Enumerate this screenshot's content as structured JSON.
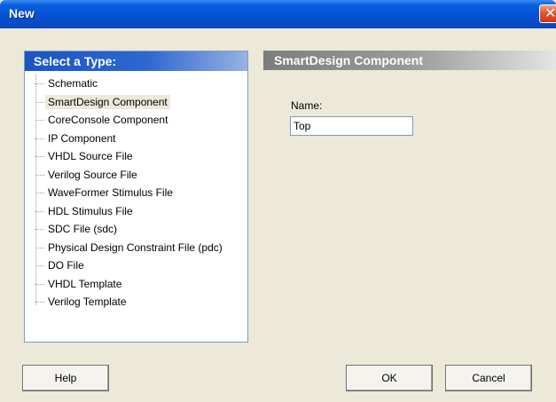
{
  "window": {
    "title": "New",
    "close_glyph": "✕",
    "close_icon": "close-icon"
  },
  "list": {
    "header": "Select a Type:",
    "items": [
      {
        "label": "Schematic"
      },
      {
        "label": "SmartDesign Component",
        "selected": true
      },
      {
        "label": "CoreConsole Component"
      },
      {
        "label": "IP Component"
      },
      {
        "label": "VHDL Source File"
      },
      {
        "label": "Verilog Source File"
      },
      {
        "label": "WaveFormer Stimulus File"
      },
      {
        "label": "HDL Stimulus File"
      },
      {
        "label": "SDC File (sdc)"
      },
      {
        "label": "Physical Design Constraint File (pdc)"
      },
      {
        "label": "DO File"
      },
      {
        "label": "VHDL Template"
      },
      {
        "label": "Verilog Template"
      }
    ]
  },
  "detail": {
    "header": "SmartDesign Component",
    "name_label": "Name:",
    "name_value": "Top"
  },
  "buttons": {
    "help": "Help",
    "ok": "OK",
    "cancel": "Cancel"
  },
  "colors": {
    "titlebar": "#0550d4",
    "list_header": "#1b55c4",
    "detail_header": "#9a9a9a",
    "dialog_bg": "#ece9d8"
  }
}
